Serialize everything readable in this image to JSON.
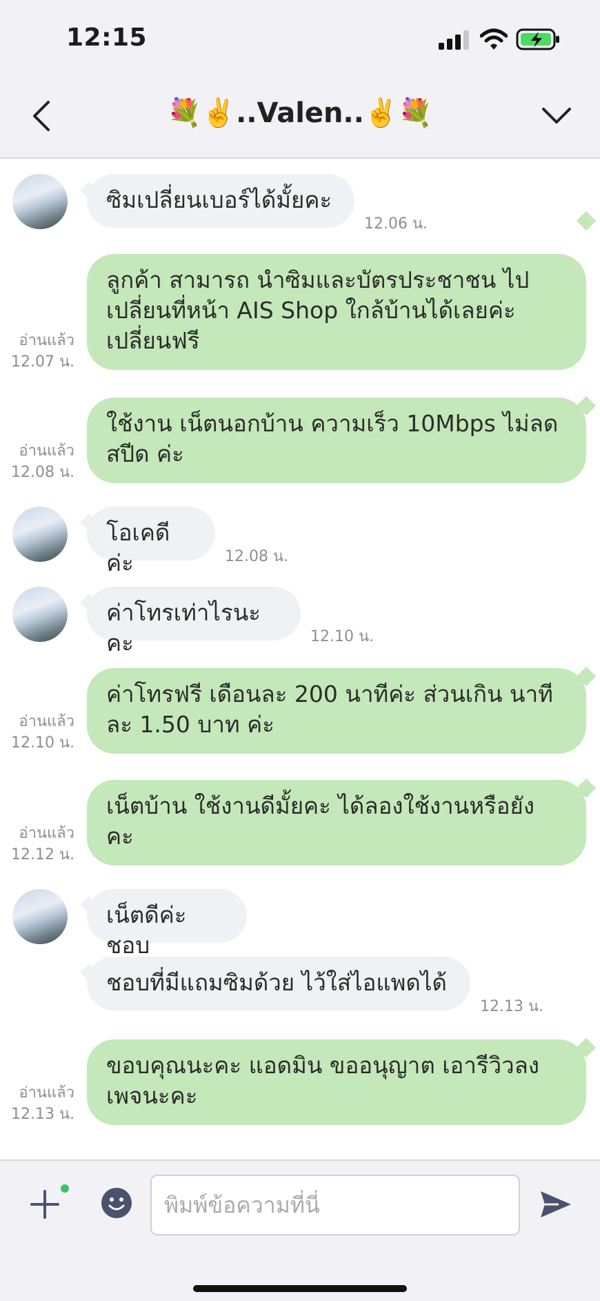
{
  "status_bar": {
    "time": "12:15"
  },
  "header": {
    "title": "💐✌️..Valen..✌️💐"
  },
  "messages": [
    {
      "direction": "in",
      "text": "ซิมเปลี่ยนเบอร์ได้มั้ยคะ",
      "time": "12.06 น."
    },
    {
      "direction": "out",
      "text": "ลูกค้า สามารถ นำซิมและบัตรประชาชน ไป เปลี่ยนที่หน้า AIS Shop ใกล้บ้านได้เลยค่ะ เปลี่ยนฟรี",
      "read": "อ่านแล้ว",
      "time": "12.07 น."
    },
    {
      "direction": "out",
      "text": "ใช้งาน เน็ตนอกบ้าน ความเร็ว 10Mbps ไม่ลด สปีด ค่ะ",
      "read": "อ่านแล้ว",
      "time": "12.08 น."
    },
    {
      "direction": "in",
      "text": "โอเคดีค่ะ",
      "time": "12.08 น."
    },
    {
      "direction": "in",
      "text": "ค่าโทรเท่าไรนะคะ",
      "time": "12.10 น."
    },
    {
      "direction": "out",
      "text": "ค่าโทรฟรี เดือนละ 200 นาทีค่ะ ส่วนเกิน นาที ละ 1.50 บาท ค่ะ",
      "read": "อ่านแล้ว",
      "time": "12.10 น."
    },
    {
      "direction": "out",
      "text": "เน็ตบ้าน ใช้งานดีมั้ยคะ ได้ลองใช้งานหรือยัง คะ",
      "read": "อ่านแล้ว",
      "time": "12.12 น."
    },
    {
      "direction": "in",
      "text": "เน็ตดีค่ะชอบ"
    },
    {
      "direction": "in",
      "text": "ชอบที่มีแถมซิมด้วย ไว้ใส่ไอแพดได้",
      "time": "12.13 น."
    },
    {
      "direction": "out",
      "text": "ขอบคุณนะคะ แอดมิน ขออนุญาต เอารีวิวลง เพจนะคะ",
      "read": "อ่านแล้ว",
      "time": "12.13 น."
    }
  ],
  "input": {
    "placeholder": "พิมพ์ข้อความที่นี่",
    "value": ""
  },
  "icons": {
    "back": "chevron-left-icon",
    "menu": "chevron-down-icon",
    "plus": "plus-icon",
    "emoji": "smiley-icon",
    "send": "send-icon"
  },
  "colors": {
    "outgoing_bubble": "#c4e8b9",
    "incoming_bubble": "#f0f1f4",
    "online_dot": "#3bc26a",
    "battery_charging": "#4cd964"
  }
}
